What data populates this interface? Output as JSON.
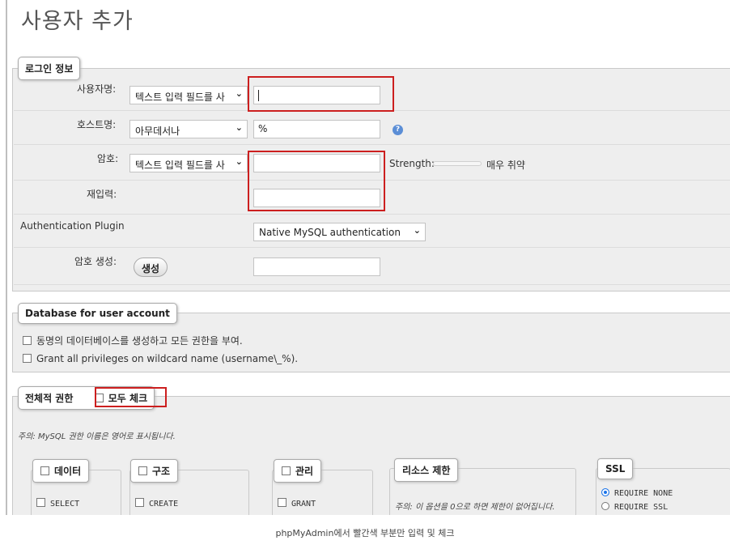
{
  "page_title": "사용자 추가",
  "login": {
    "legend": "로그인 정보",
    "username": {
      "label": "사용자명:",
      "select": "텍스트 입력 필드를 사",
      "value": ""
    },
    "hostname": {
      "label": "호스트명:",
      "select": "아무데서나",
      "value": "%",
      "help_icon": "question-icon"
    },
    "password": {
      "label": "암호:",
      "select": "텍스트 입력 필드를 사",
      "value": "",
      "strength_label": "Strength:",
      "strength_value": "매우 취약"
    },
    "retype": {
      "label": "재입력:",
      "value": ""
    },
    "auth_plugin": {
      "label": "Authentication Plugin",
      "select": "Native MySQL authentication"
    },
    "generate": {
      "label": "암호 생성:",
      "button": "생성",
      "value": ""
    }
  },
  "database": {
    "legend": "Database for user account",
    "options": [
      "동명의 데이터베이스를 생성하고 모든 권한을 부여.",
      "Grant all privileges on wildcard name (username\\_%)."
    ]
  },
  "global_privileges": {
    "legend": "전체적 권한",
    "check_all": "모두 체크",
    "note": "주의: MySQL 권한 이름은 영어로 표시됩니다.",
    "groups": {
      "data": {
        "legend": "데이터",
        "first_item": "SELECT"
      },
      "structure": {
        "legend": "구조",
        "first_item": "CREATE"
      },
      "admin": {
        "legend": "관리",
        "first_item": "GRANT"
      },
      "resources": {
        "legend": "리소스 제한",
        "note": "주의: 이 옵션을 0으로 하면 제한이 없어집니다."
      },
      "ssl": {
        "legend": "SSL",
        "options": [
          "REQUIRE NONE",
          "REQUIRE SSL"
        ],
        "selected": "REQUIRE NONE"
      }
    }
  },
  "highlight_color": "#cc1f1f",
  "caption": "phpMyAdmin에서 빨간색 부분만 입력 및 체크"
}
